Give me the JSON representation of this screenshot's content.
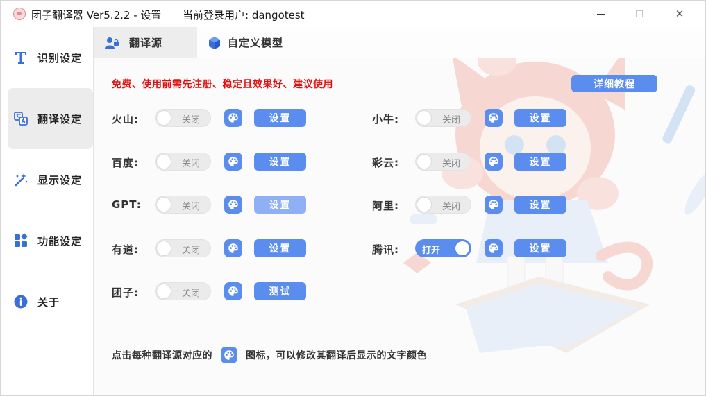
{
  "window": {
    "title": "团子翻译器 Ver5.2.2 - 设置",
    "user_label": "当前登录用户: dangotest",
    "minimize_icon": "minimize-icon",
    "maximize_icon": "maximize-icon",
    "close_glyph": "✕"
  },
  "sidebar": {
    "items": [
      {
        "label": "识别设定",
        "icon": "text-t-icon"
      },
      {
        "label": "翻译设定",
        "icon": "translate-icon",
        "active": true
      },
      {
        "label": "显示设定",
        "icon": "magic-wand-icon"
      },
      {
        "label": "功能设定",
        "icon": "apps-icon"
      },
      {
        "label": "关于",
        "icon": "info-icon"
      }
    ]
  },
  "tabs": [
    {
      "label": "翻译源",
      "icon": "user-lock-icon",
      "active": true
    },
    {
      "label": "自定义模型",
      "icon": "cube-icon"
    }
  ],
  "notice": "免费、使用前需先注册、稳定且效果好、建议使用",
  "tutorial_button": "详细教程",
  "sources": {
    "left": [
      {
        "name": "火山:",
        "state": "关闭",
        "on": false,
        "button": "设置"
      },
      {
        "name": "百度:",
        "state": "关闭",
        "on": false,
        "button": "设置"
      },
      {
        "name": "GPT:",
        "state": "关闭",
        "on": false,
        "button": "设置",
        "dim": true
      },
      {
        "name": "有道:",
        "state": "关闭",
        "on": false,
        "button": "设置"
      },
      {
        "name": "团子:",
        "state": "关闭",
        "on": false,
        "button": "测试"
      }
    ],
    "right": [
      {
        "name": "小牛:",
        "state": "关闭",
        "on": false,
        "button": "设置"
      },
      {
        "name": "彩云:",
        "state": "关闭",
        "on": false,
        "button": "设置"
      },
      {
        "name": "阿里:",
        "state": "关闭",
        "on": false,
        "button": "设置"
      },
      {
        "name": "腾讯:",
        "state": "打开",
        "on": true,
        "button": "设置"
      }
    ]
  },
  "footer": {
    "before": "点击每种翻译源对应的",
    "after": "图标，可以修改其翻译后显示的文字颜色"
  },
  "colors": {
    "accent": "#5b8def",
    "notice": "#e01010"
  }
}
